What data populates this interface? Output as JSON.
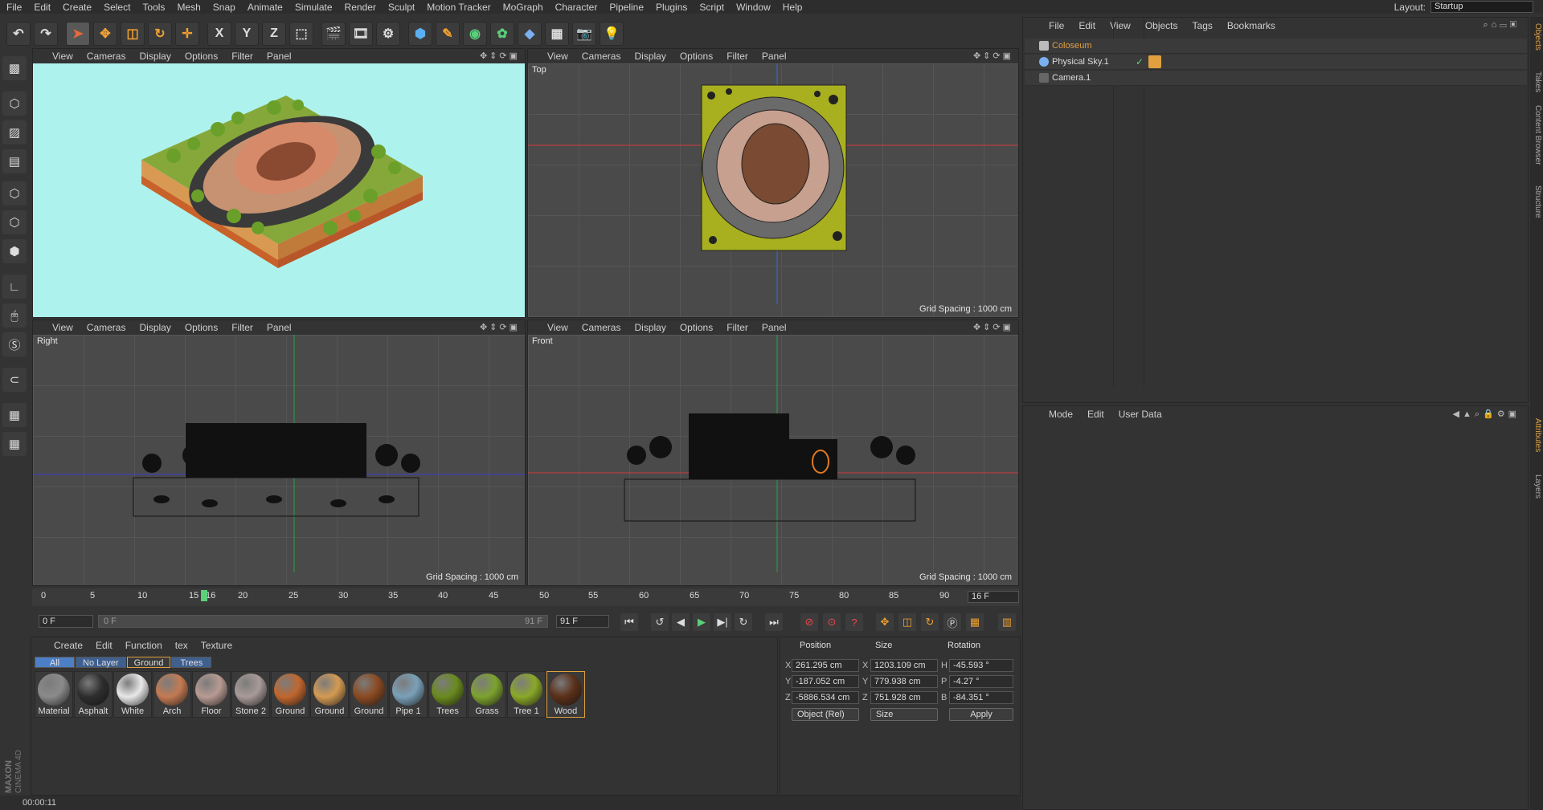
{
  "menu": [
    "File",
    "Edit",
    "Create",
    "Select",
    "Tools",
    "Mesh",
    "Snap",
    "Animate",
    "Simulate",
    "Render",
    "Sculpt",
    "Motion Tracker",
    "MoGraph",
    "Character",
    "Pipeline",
    "Plugins",
    "Script",
    "Window",
    "Help"
  ],
  "layout": {
    "label": "Layout:",
    "value": "Startup"
  },
  "toolbar": {
    "x": "X",
    "y": "Y",
    "z": "Z"
  },
  "viewport_menu": [
    "View",
    "Cameras",
    "Display",
    "Options",
    "Filter",
    "Panel"
  ],
  "viewports": {
    "perspective": {
      "name": ""
    },
    "top": {
      "name": "Top",
      "grid": "Grid Spacing : 1000 cm"
    },
    "right": {
      "name": "Right",
      "grid": "Grid Spacing : 1000 cm"
    },
    "front": {
      "name": "Front",
      "grid": "Grid Spacing : 1000 cm"
    }
  },
  "timeline": {
    "ticks": [
      "0",
      "5",
      "10",
      "15",
      "16",
      "20",
      "25",
      "30",
      "35",
      "40",
      "45",
      "50",
      "55",
      "60",
      "65",
      "70",
      "75",
      "80",
      "85",
      "90"
    ],
    "current_frame": "16 F",
    "start": "0 F",
    "slider_start": "0 F",
    "slider_end": "91 F",
    "end": "91 F"
  },
  "materials_menu": [
    "Create",
    "Edit",
    "Function",
    "tex",
    "Texture"
  ],
  "layers": [
    "All",
    "No Layer",
    "Ground",
    "Trees"
  ],
  "materials": [
    {
      "name": "Material",
      "color": "#8a8a8a"
    },
    {
      "name": "Asphalt",
      "color": "#2e2e2e"
    },
    {
      "name": "White",
      "color": "#e8e8e8"
    },
    {
      "name": "Arch",
      "color": "#c47a52"
    },
    {
      "name": "Floor",
      "color": "#b89a92"
    },
    {
      "name": "Stone 2",
      "color": "#a89a98"
    },
    {
      "name": "Ground",
      "color": "#c0662e"
    },
    {
      "name": "Ground",
      "color": "#d49a52"
    },
    {
      "name": "Ground",
      "color": "#8a4a22"
    },
    {
      "name": "Pipe 1",
      "color": "#7aa0b8"
    },
    {
      "name": "Trees",
      "color": "#6a8a1e"
    },
    {
      "name": "Grass",
      "color": "#7ca22e"
    },
    {
      "name": "Tree 1",
      "color": "#8aa828"
    },
    {
      "name": "Wood",
      "color": "#5a3018"
    }
  ],
  "coords": {
    "headers": [
      "Position",
      "Size",
      "Rotation"
    ],
    "pos": {
      "x": "261.295 cm",
      "y": "-187.052 cm",
      "z": "-5886.534 cm"
    },
    "size": {
      "x": "1203.109 cm",
      "y": "779.938 cm",
      "z": "751.928 cm"
    },
    "rot": {
      "h": "-45.593 °",
      "p": "-4.27 °",
      "b": "-84.351 °"
    },
    "mode": "Object (Rel)",
    "size_mode": "Size",
    "apply": "Apply"
  },
  "objects_menu": [
    "File",
    "Edit",
    "View",
    "Objects",
    "Tags",
    "Bookmarks"
  ],
  "objects": [
    {
      "name": "Coloseum",
      "active": true
    },
    {
      "name": "Physical Sky.1",
      "active": false
    },
    {
      "name": "Camera.1",
      "active": false
    }
  ],
  "attributes_menu": [
    "Mode",
    "Edit",
    "User Data"
  ],
  "right_tabs": [
    "Objects",
    "Takes",
    "Content Browser",
    "Structure",
    "Attributes",
    "Layers"
  ],
  "status": "00:00:11",
  "brand": "MAXON CINEMA 4D"
}
